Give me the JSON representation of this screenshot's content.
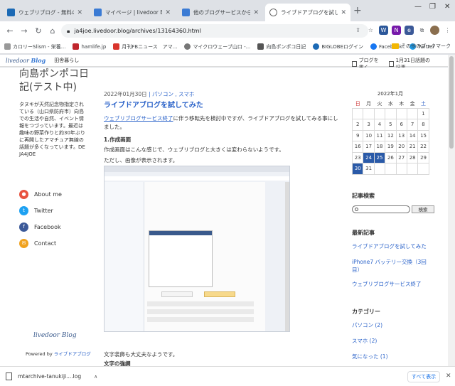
{
  "tabs": [
    {
      "title": "ウェブリブログ - 無料のブログ(blog)",
      "color": "#1c6ab5"
    },
    {
      "title": "マイページ | livedoor Blog",
      "color": "#3b7bd4"
    },
    {
      "title": "他のブログサービスからのお引越し",
      "color": "#3b7bd4"
    },
    {
      "title": "ライブドアブログを試してみた：向島",
      "color": "#666666"
    }
  ],
  "url": "ja4joe.livedoor.blog/archives/13164360.html",
  "bookmarks": [
    "カロリーSlism - 栄養...",
    "hamlife.jp",
    "月刊FBニュース　アマ...",
    "マイクロウェーブ山口 -...",
    "向島ポンポコ日記",
    "BIGLOBEログイン",
    "Facebook",
    "Twitter"
  ],
  "bookmarks_other": "その他のブックマーク",
  "livedoor_bar": {
    "logo_a": "livedoor",
    "logo_b": "Blog",
    "user": "田舎暮らし",
    "write": "ブログを書く",
    "topic": "1月31日話題の記事"
  },
  "blog": {
    "title": "向島ポンポコ日記(テスト中)",
    "description": "タヌキが天然記念物指定されている（山口県防府市）向島での生活や自然、イベント情報をつづっています。最近は趣味の野菜作りと約30年ぶりに再開したアマチュア無線の話題が多くなっています。DE JA4JOE",
    "social": [
      {
        "label": "About me",
        "color": "#e8533f",
        "glyph": "●"
      },
      {
        "label": "Twitter",
        "color": "#1da1f2",
        "glyph": "t"
      },
      {
        "label": "Facebook",
        "color": "#3b5998",
        "glyph": "f"
      },
      {
        "label": "Contact",
        "color": "#f0a21f",
        "glyph": "✉"
      }
    ],
    "footer_logo": "livedoor Blog",
    "powered_prefix": "Powered by ",
    "powered_link": "ライブドアブログ"
  },
  "post": {
    "date": "2022年01月30日",
    "cats": "| パソコン , スマホ",
    "title": "ライブドアブログを試してみた",
    "p1_link": "ウェブリブログサービス終了",
    "p1_rest": "に伴う移転先を検討中ですが、ライブドアブログを試してみる事にしました。",
    "h1": "1.作成画面",
    "p2": "作成画面はこんな感じで、ウェブリブログと大きくは変わらないようです。",
    "p3": "ただし、画像が表示されます。",
    "p4": "文字装飾も大丈夫なようです。",
    "h2": "文字の強調"
  },
  "calendar": {
    "title": "2022年1月",
    "weekdays": [
      "日",
      "月",
      "火",
      "水",
      "木",
      "金",
      "土"
    ],
    "rows": [
      [
        "",
        "",
        "",
        "",
        "",
        "",
        "1"
      ],
      [
        "2",
        "3",
        "4",
        "5",
        "6",
        "7",
        "8"
      ],
      [
        "9",
        "10",
        "11",
        "12",
        "13",
        "14",
        "15"
      ],
      [
        "16",
        "17",
        "18",
        "19",
        "20",
        "21",
        "22"
      ],
      [
        "23",
        "24",
        "25",
        "26",
        "27",
        "28",
        "29"
      ],
      [
        "30",
        "31",
        "",
        "",
        "",
        "",
        ""
      ]
    ],
    "highlighted": [
      "24",
      "25",
      "30"
    ]
  },
  "sidebar": {
    "search_title": "記事検索",
    "search_button": "検索",
    "recent_title": "最新記事",
    "recent": [
      "ライブドアブログを試してみた",
      "iPhone7 バッテリー交換（3回目）",
      "ウェブリブログサービス終了"
    ],
    "category_title": "カテゴリー",
    "categories": [
      "パソコン (2)",
      "スマホ (2)",
      "気になった (1)"
    ]
  },
  "download": {
    "file": "mtarchive-tanukiji....log",
    "show_all": "すべて表示"
  }
}
